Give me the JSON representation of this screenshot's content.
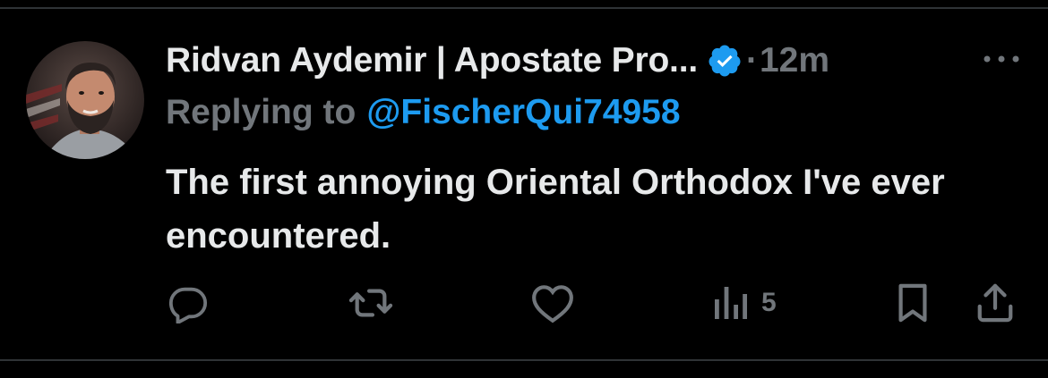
{
  "tweet": {
    "display_name": "Ridvan Aydemir | Apostate Pro...",
    "separator": "·",
    "time": "12m",
    "replying_prefix": "Replying to",
    "replying_handle": "@FischerQui74958",
    "text": "The first annoying Oriental Orthodox I've ever encountered.",
    "verified": true
  },
  "actions": {
    "reply_icon": "reply-icon",
    "retweet_icon": "retweet-icon",
    "like_icon": "like-icon",
    "views_icon": "views-icon",
    "views_count": "5",
    "bookmark_icon": "bookmark-icon",
    "share_icon": "share-icon"
  },
  "colors": {
    "background": "#000000",
    "text_primary": "#e7e9ea",
    "text_secondary": "#71767b",
    "accent": "#1d9bf0",
    "divider": "#2f3336"
  }
}
